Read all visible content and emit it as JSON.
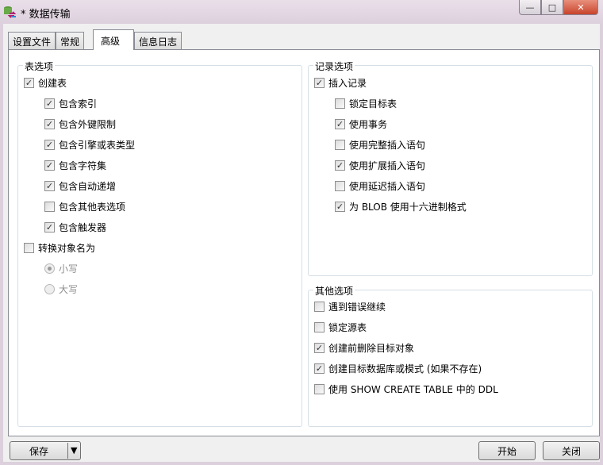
{
  "window": {
    "title": "* 数据传输",
    "min": "—",
    "max": "□",
    "close": "✕"
  },
  "tabs": [
    {
      "label": "设置文件"
    },
    {
      "label": "常规"
    },
    {
      "label": "高级",
      "active": true
    },
    {
      "label": "信息日志"
    }
  ],
  "table_options": {
    "title": "表选项",
    "create_table": {
      "label": "创建表",
      "checked": true
    },
    "sub": [
      {
        "label": "包含索引",
        "checked": true
      },
      {
        "label": "包含外键限制",
        "checked": true
      },
      {
        "label": "包含引擎或表类型",
        "checked": true
      },
      {
        "label": "包含字符集",
        "checked": true
      },
      {
        "label": "包含自动递增",
        "checked": true
      },
      {
        "label": "包含其他表选项",
        "checked": false
      },
      {
        "label": "包含触发器",
        "checked": true
      }
    ],
    "convert": {
      "label": "转换对象名为",
      "checked": false
    },
    "radios": [
      {
        "label": "小写",
        "selected": true
      },
      {
        "label": "大写",
        "selected": false
      }
    ]
  },
  "record_options": {
    "title": "记录选项",
    "insert": {
      "label": "插入记录",
      "checked": true
    },
    "sub": [
      {
        "label": "锁定目标表",
        "checked": false
      },
      {
        "label": "使用事务",
        "checked": true
      },
      {
        "label": "使用完整插入语句",
        "checked": false
      },
      {
        "label": "使用扩展插入语句",
        "checked": true
      },
      {
        "label": "使用延迟插入语句",
        "checked": false
      },
      {
        "label": "为 BLOB 使用十六进制格式",
        "checked": true
      }
    ]
  },
  "other_options": {
    "title": "其他选项",
    "items": [
      {
        "label": "遇到错误继续",
        "checked": false
      },
      {
        "label": "锁定源表",
        "checked": false
      },
      {
        "label": "创建前删除目标对象",
        "checked": true
      },
      {
        "label": "创建目标数据库或模式 (如果不存在)",
        "checked": true
      },
      {
        "label": "使用 SHOW CREATE TABLE 中的 DDL",
        "checked": false
      }
    ]
  },
  "buttons": {
    "save": "保存",
    "dropdown": "▼",
    "start": "开始",
    "close": "关闭"
  }
}
